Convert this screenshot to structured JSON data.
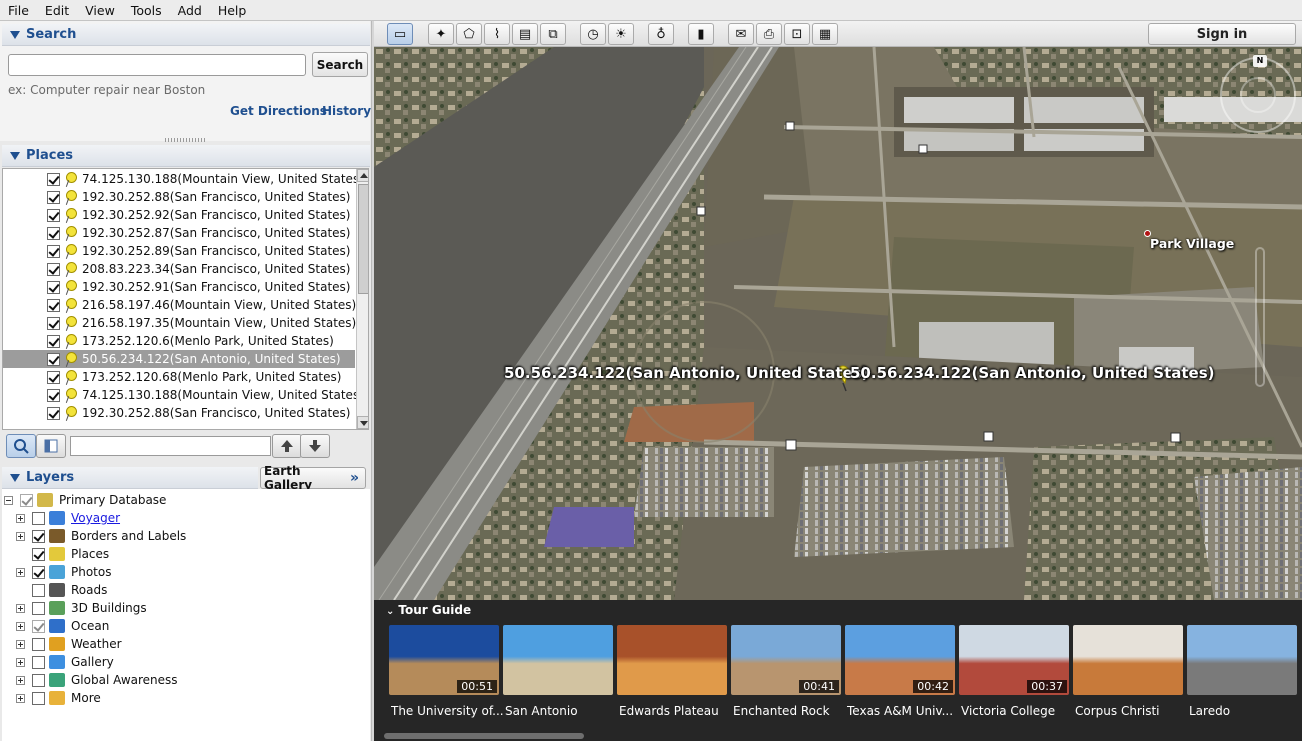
{
  "menu": [
    {
      "label": "File",
      "mnemonic": "F",
      "rest": "ile"
    },
    {
      "label": "Edit",
      "mnemonic": "E",
      "rest": "dit"
    },
    {
      "label": "View",
      "mnemonic": "V",
      "rest": "iew"
    },
    {
      "label": "Tools",
      "mnemonic": "T",
      "rest": "ools"
    },
    {
      "label": "Add",
      "mnemonic": "A",
      "rest": "dd"
    },
    {
      "label": "Help",
      "mnemonic": "H",
      "rest": "elp"
    }
  ],
  "search": {
    "title": "Search",
    "input_value": "",
    "button": "Search",
    "hint": "ex: Computer repair near Boston",
    "get_directions": "Get Directions",
    "history": "History"
  },
  "places": {
    "title": "Places",
    "items": [
      {
        "label": "74.125.130.188(Mountain View, United States)",
        "checked": true,
        "selected": false
      },
      {
        "label": "192.30.252.88(San Francisco, United States)",
        "checked": true,
        "selected": false
      },
      {
        "label": "192.30.252.92(San Francisco, United States)",
        "checked": true,
        "selected": false
      },
      {
        "label": "192.30.252.87(San Francisco, United States)",
        "checked": true,
        "selected": false
      },
      {
        "label": "192.30.252.89(San Francisco, United States)",
        "checked": true,
        "selected": false
      },
      {
        "label": "208.83.223.34(San Francisco, United States)",
        "checked": true,
        "selected": false
      },
      {
        "label": "192.30.252.91(San Francisco, United States)",
        "checked": true,
        "selected": false
      },
      {
        "label": "216.58.197.46(Mountain View, United States)",
        "checked": true,
        "selected": false
      },
      {
        "label": "216.58.197.35(Mountain View, United States)",
        "checked": true,
        "selected": false
      },
      {
        "label": "173.252.120.6(Menlo Park, United States)",
        "checked": true,
        "selected": false
      },
      {
        "label": "50.56.234.122(San Antonio, United States)",
        "checked": true,
        "selected": true
      },
      {
        "label": "173.252.120.68(Menlo Park, United States)",
        "checked": true,
        "selected": false
      },
      {
        "label": "74.125.130.188(Mountain View, United States)",
        "checked": true,
        "selected": false
      },
      {
        "label": "192.30.252.88(San Francisco, United States)",
        "checked": true,
        "selected": false
      }
    ],
    "filter_value": ""
  },
  "layers": {
    "title": "Layers",
    "earth_gallery": "Earth Gallery",
    "items": [
      {
        "label": "Primary Database",
        "expander": "minus",
        "check": "gray-on",
        "icon_color": "#d2b84a",
        "link": false
      },
      {
        "label": "Voyager",
        "expander": "plus",
        "check": "off",
        "icon_color": "#3b7fd9",
        "link": true
      },
      {
        "label": "Borders and Labels",
        "expander": "plus",
        "check": "on",
        "icon_color": "#7a5a2a",
        "link": false
      },
      {
        "label": "Places",
        "expander": "none",
        "check": "on",
        "icon_color": "#e3c93b",
        "link": false
      },
      {
        "label": "Photos",
        "expander": "plus",
        "check": "on",
        "icon_color": "#4aa3d8",
        "link": false
      },
      {
        "label": "Roads",
        "expander": "none",
        "check": "off",
        "icon_color": "#555555",
        "link": false
      },
      {
        "label": "3D Buildings",
        "expander": "plus",
        "check": "off",
        "icon_color": "#5aa05a",
        "link": false
      },
      {
        "label": "Ocean",
        "expander": "plus",
        "check": "gray-on",
        "icon_color": "#2f6fc9",
        "link": false
      },
      {
        "label": "Weather",
        "expander": "plus",
        "check": "off",
        "icon_color": "#e0a020",
        "link": false
      },
      {
        "label": "Gallery",
        "expander": "plus",
        "check": "off",
        "icon_color": "#3d8fe0",
        "link": false
      },
      {
        "label": "Global Awareness",
        "expander": "plus",
        "check": "off",
        "icon_color": "#3aa37a",
        "link": false
      },
      {
        "label": "More",
        "expander": "plus",
        "check": "off",
        "icon_color": "#e8b23a",
        "link": false
      }
    ]
  },
  "toolbar": {
    "buttons": [
      {
        "name": "sidebar-toggle-icon",
        "glyph": "▭",
        "active": true
      },
      {
        "name": "add-placemark-icon",
        "glyph": "✦",
        "active": false
      },
      {
        "name": "add-polygon-icon",
        "glyph": "⬠",
        "active": false
      },
      {
        "name": "add-path-icon",
        "glyph": "⌇",
        "active": false
      },
      {
        "name": "add-image-overlay-icon",
        "glyph": "▤",
        "active": false
      },
      {
        "name": "record-tour-icon",
        "glyph": "⧉",
        "active": false
      },
      {
        "name": "historical-imagery-icon",
        "glyph": "◷",
        "active": false
      },
      {
        "name": "sunlight-icon",
        "glyph": "☀",
        "active": false
      },
      {
        "name": "planet-switch-icon",
        "glyph": "♁",
        "active": false
      },
      {
        "name": "ruler-icon",
        "glyph": "▮",
        "active": false
      },
      {
        "name": "email-icon",
        "glyph": "✉",
        "active": false
      },
      {
        "name": "print-icon",
        "glyph": "⎙",
        "active": false
      },
      {
        "name": "save-image-icon",
        "glyph": "⊡",
        "active": false
      },
      {
        "name": "view-in-maps-icon",
        "glyph": "▦",
        "active": false
      }
    ],
    "sign_in": "Sign in"
  },
  "map": {
    "placemark_label": "50.56.234.122(San Antonio, United States)",
    "park_village": "Park Village"
  },
  "tour_guide": {
    "title": "Tour Guide",
    "cards": [
      {
        "label": "The University of...",
        "duration": "00:51",
        "colors": [
          "#1c4c9e",
          "#b58b5a"
        ]
      },
      {
        "label": "San Antonio",
        "duration": "",
        "colors": [
          "#4f9fe0",
          "#d2c3a1"
        ]
      },
      {
        "label": "Edwards Plateau",
        "duration": "",
        "colors": [
          "#a8512a",
          "#e09a4a"
        ]
      },
      {
        "label": "Enchanted Rock",
        "duration": "00:41",
        "colors": [
          "#7aa9d7",
          "#b8956f"
        ]
      },
      {
        "label": "Texas A&M Univ...",
        "duration": "00:42",
        "colors": [
          "#5c9fe0",
          "#c87a48"
        ]
      },
      {
        "label": "Victoria College",
        "duration": "00:37",
        "colors": [
          "#cfd9e3",
          "#b24a3c"
        ]
      },
      {
        "label": "Corpus Christi",
        "duration": "",
        "colors": [
          "#e6e1d9",
          "#c87a3a"
        ]
      },
      {
        "label": "Laredo",
        "duration": "",
        "colors": [
          "#86b3e0",
          "#7a7a7a"
        ]
      }
    ]
  }
}
